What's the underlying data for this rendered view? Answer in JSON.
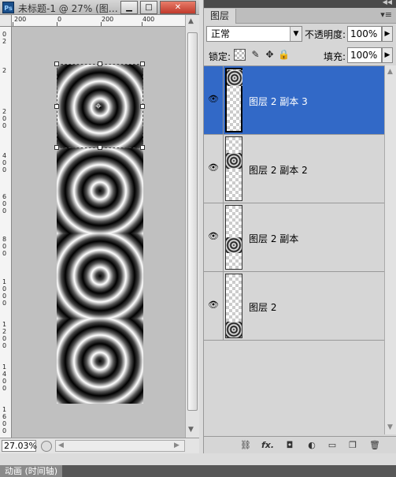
{
  "document": {
    "title": "未标题-1 @ 27% (图…",
    "app_icon": "Ps",
    "zoom": "27.03%",
    "ruler_h_labels": [
      "200",
      "0",
      "200",
      "400"
    ],
    "ruler_v_labels": [
      "0",
      "2",
      "0",
      "0",
      "4",
      "0",
      "0",
      "6",
      "0",
      "0",
      "8",
      "0",
      "0",
      "1",
      "0",
      "0",
      "0",
      "1",
      "2",
      "0",
      "0",
      "1",
      "4",
      "0",
      "0",
      "1",
      "6",
      "0",
      "0"
    ],
    "window_buttons": {
      "minimize": "▁",
      "maximize": "□",
      "close": "✕"
    }
  },
  "layers_panel": {
    "tab_label": "图层",
    "blend_mode": "正常",
    "opacity_label": "不透明度:",
    "opacity_value": "100%",
    "lock_label": "锁定:",
    "fill_label": "填充:",
    "fill_value": "100%",
    "layers": [
      {
        "name": "图层 2 副本 3",
        "selected": true,
        "visible": true
      },
      {
        "name": "图层 2 副本 2",
        "selected": false,
        "visible": true
      },
      {
        "name": "图层 2 副本",
        "selected": false,
        "visible": true
      },
      {
        "name": "图层 2",
        "selected": false,
        "visible": true
      }
    ],
    "footer_icons": [
      "link-icon",
      "fx-icon",
      "mask-icon",
      "adjustment-icon",
      "group-folder-icon",
      "new-layer-icon",
      "trash-icon"
    ],
    "footer_glyphs": {
      "link": "⛓",
      "fx": "fx.",
      "mask": "◘",
      "adjustment": "◐",
      "group": "▭",
      "new_layer": "❐",
      "trash": "🗑"
    }
  },
  "bottom": {
    "animation_tab": "动画 (时间轴)"
  },
  "colors": {
    "selection_blue": "#3269c7",
    "canvas_bg": "#c0c0c0",
    "panel_bg": "#d6d6d6"
  }
}
